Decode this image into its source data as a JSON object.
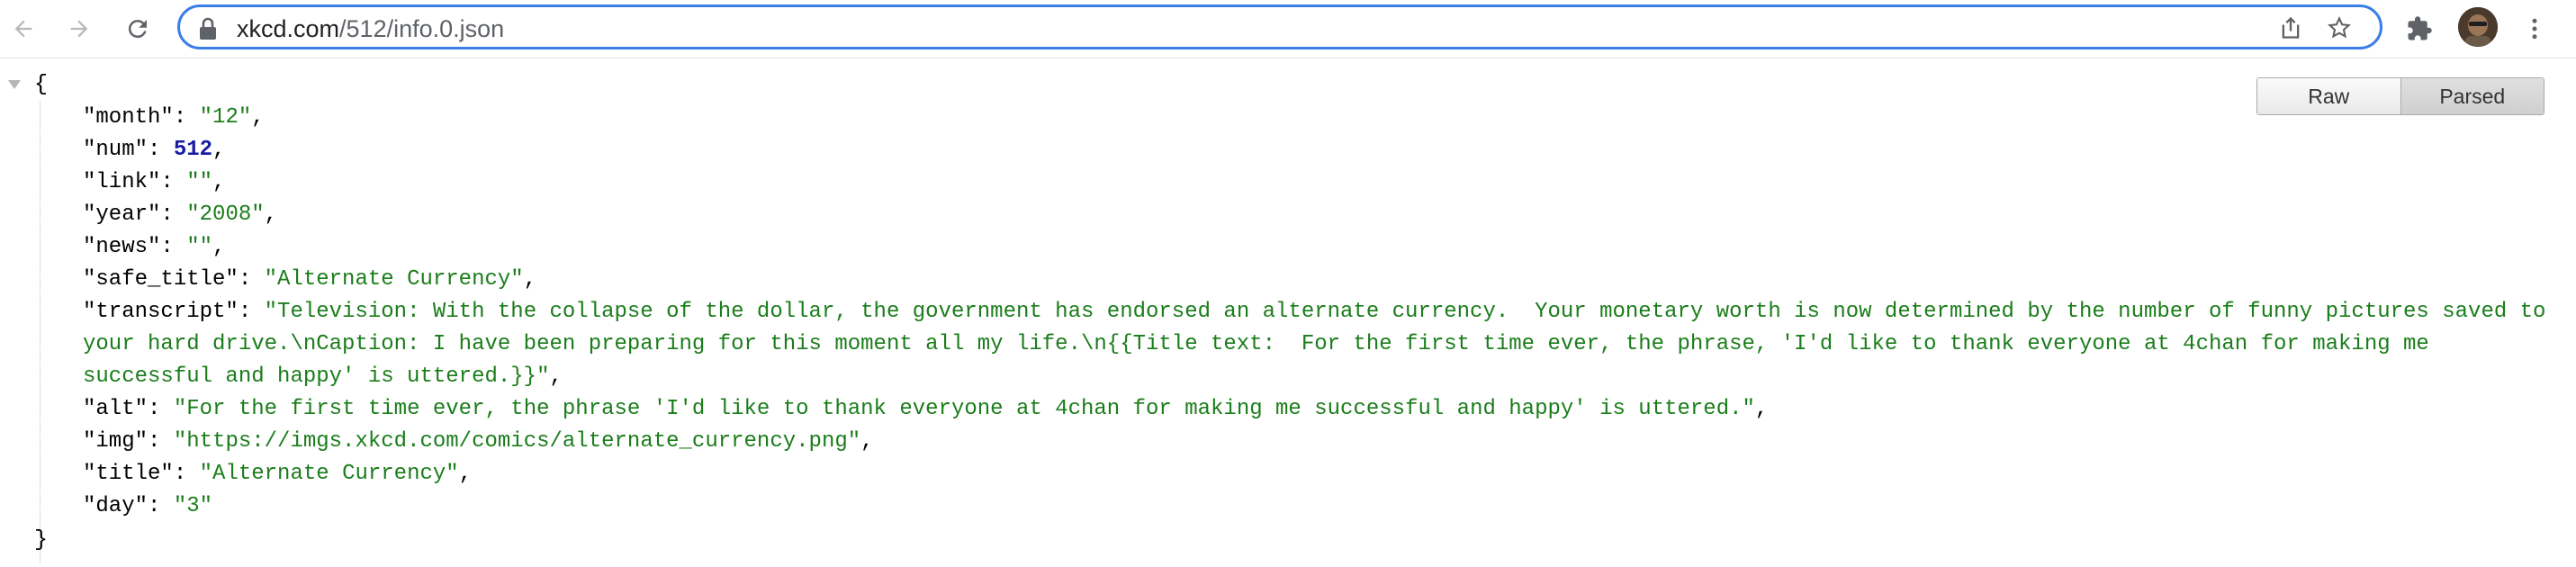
{
  "browser": {
    "url_domain": "xkcd.com",
    "url_path": "/512/info.0.json",
    "icons": [
      "back-arrow-icon",
      "forward-arrow-icon",
      "reload-icon",
      "lock-icon",
      "share-icon",
      "star-icon",
      "puzzle-extensions-icon",
      "avatar",
      "more-vert-icon"
    ]
  },
  "viewer": {
    "toggle": {
      "raw": "Raw",
      "parsed": "Parsed",
      "selected": "Parsed"
    },
    "open_brace": "{",
    "close_brace": "}",
    "entries": [
      {
        "key": "\"month\"",
        "value": "\"12\"",
        "type": "string"
      },
      {
        "key": "\"num\"",
        "value": "512",
        "type": "number"
      },
      {
        "key": "\"link\"",
        "value": "\"\"",
        "type": "string"
      },
      {
        "key": "\"year\"",
        "value": "\"2008\"",
        "type": "string"
      },
      {
        "key": "\"news\"",
        "value": "\"\"",
        "type": "string"
      },
      {
        "key": "\"safe_title\"",
        "value": "\"Alternate Currency\"",
        "type": "string"
      },
      {
        "key": "\"transcript\"",
        "value": "\"Television: With the collapse of the dollar, the government has endorsed an alternate currency.  Your monetary worth is now determined by the number of funny pictures saved to your hard drive.\\nCaption: I have been preparing for this moment all my life.\\n{{Title text:  For the first time ever, the phrase, 'I'd like to thank everyone at 4chan for making me successful and happy' is uttered.}}\"",
        "type": "string"
      },
      {
        "key": "\"alt\"",
        "value": "\"For the first time ever, the phrase 'I'd like to thank everyone at 4chan for making me successful and happy' is uttered.\"",
        "type": "string"
      },
      {
        "key": "\"img\"",
        "value": "\"https://imgs.xkcd.com/comics/alternate_currency.png\"",
        "type": "string"
      },
      {
        "key": "\"title\"",
        "value": "\"Alternate Currency\"",
        "type": "string"
      },
      {
        "key": "\"day\"",
        "value": "\"3\"",
        "type": "string"
      }
    ]
  },
  "colors": {
    "string": "#1a7d1a",
    "number": "#1a1aa6",
    "omnibox_focus": "#3b7ee8"
  }
}
